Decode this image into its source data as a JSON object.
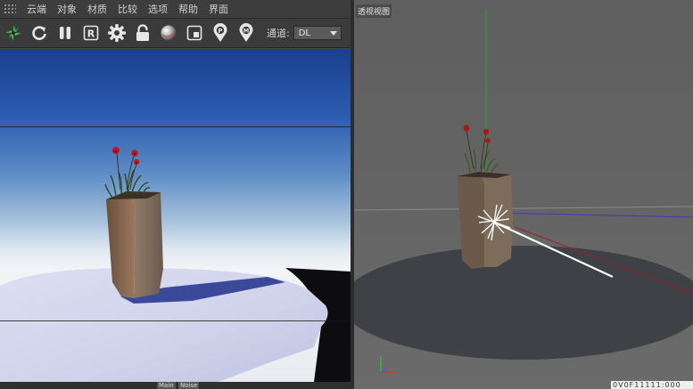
{
  "menubar": {
    "items": [
      {
        "label": "云端"
      },
      {
        "label": "对象"
      },
      {
        "label": "材质"
      },
      {
        "label": "比较"
      },
      {
        "label": "选项"
      },
      {
        "label": "帮助"
      },
      {
        "label": "界面"
      }
    ]
  },
  "toolbar": {
    "buttons": [
      {
        "name": "start-render-icon"
      },
      {
        "name": "restart-render-icon"
      },
      {
        "name": "pause-render-icon"
      },
      {
        "name": "render-region-icon",
        "glyph": "R"
      },
      {
        "name": "settings-gear-icon"
      },
      {
        "name": "lock-icon"
      },
      {
        "name": "material-sphere-icon"
      },
      {
        "name": "clay-mode-icon"
      },
      {
        "name": "pick-focus-icon",
        "glyph": "P"
      },
      {
        "name": "pick-material-icon",
        "glyph": "M"
      }
    ],
    "channel_label": "通道:",
    "channel_value": "DL"
  },
  "status_tabs": {
    "main": "Main",
    "noise": "Noise"
  },
  "viewport": {
    "title": "透视视图",
    "status_text": "0V0F11111:000"
  },
  "colors": {
    "accent_green": "#3fbf3f",
    "ui_dark": "#3b3b3b",
    "sky_top": "#1b3f8f",
    "floor": "#d6d8ee",
    "vase": "#8a6d55",
    "flower_red": "#c01818"
  }
}
